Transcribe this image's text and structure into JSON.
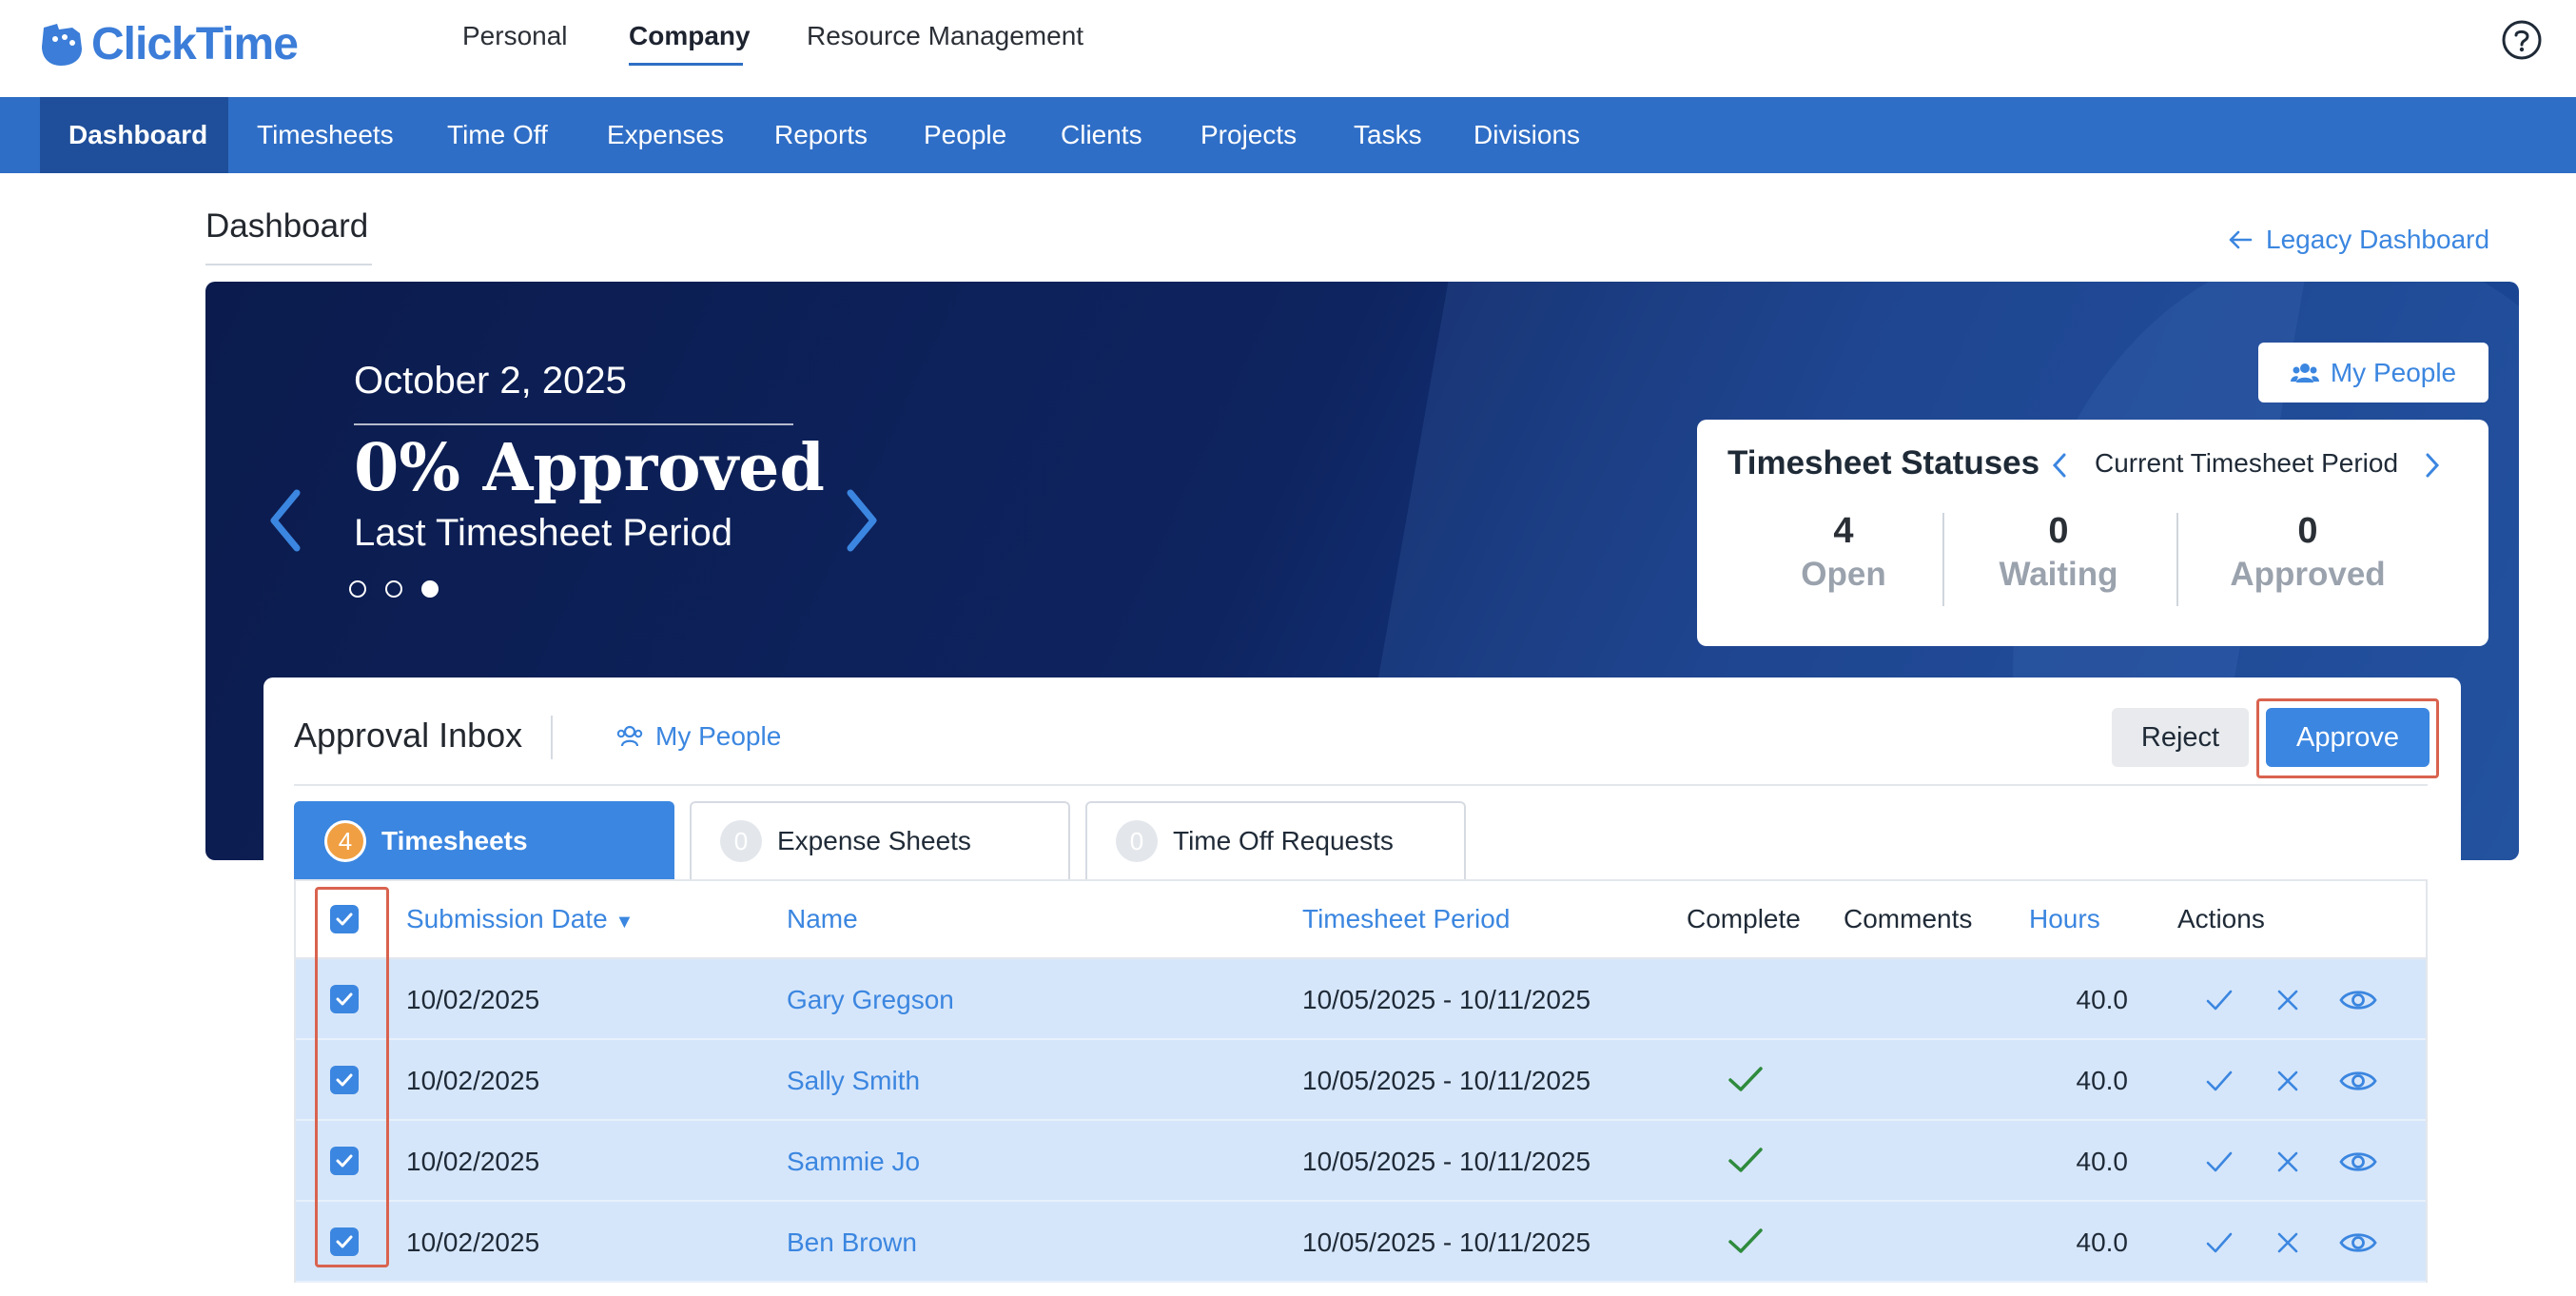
{
  "app": {
    "logo_text": "ClickTime"
  },
  "top_nav": {
    "items": [
      "Personal",
      "Company",
      "Resource Management"
    ],
    "active": "Company"
  },
  "sub_nav": {
    "items": [
      "Dashboard",
      "Timesheets",
      "Time Off",
      "Expenses",
      "Reports",
      "People",
      "Clients",
      "Projects",
      "Tasks",
      "Divisions"
    ],
    "active": "Dashboard"
  },
  "page": {
    "title": "Dashboard",
    "legacy_link": "Legacy Dashboard"
  },
  "hero": {
    "date": "October 2, 2025",
    "percent": "0% Approved",
    "subtitle": "Last Timesheet Period",
    "carousel_index": 3,
    "carousel_count": 3
  },
  "my_people_button": "My People",
  "status_card": {
    "title": "Timesheet Statuses",
    "period": "Current Timesheet Period",
    "stats": [
      {
        "value": "4",
        "label": "Open"
      },
      {
        "value": "0",
        "label": "Waiting"
      },
      {
        "value": "0",
        "label": "Approved"
      }
    ]
  },
  "inbox": {
    "title": "Approval Inbox",
    "my_people": "My People",
    "reject": "Reject",
    "approve": "Approve",
    "tabs": [
      {
        "count": "4",
        "label": "Timesheets"
      },
      {
        "count": "0",
        "label": "Expense Sheets"
      },
      {
        "count": "0",
        "label": "Time Off Requests"
      }
    ],
    "columns": {
      "submission_date": "Submission Date",
      "name": "Name",
      "period": "Timesheet Period",
      "complete": "Complete",
      "comments": "Comments",
      "hours": "Hours",
      "actions": "Actions"
    },
    "rows": [
      {
        "date": "10/02/2025",
        "name": "Gary Gregson",
        "period": "10/05/2025 - 10/11/2025",
        "complete": false,
        "hours": "40.0",
        "checked": true
      },
      {
        "date": "10/02/2025",
        "name": "Sally Smith",
        "period": "10/05/2025 - 10/11/2025",
        "complete": true,
        "hours": "40.0",
        "checked": true
      },
      {
        "date": "10/02/2025",
        "name": "Sammie Jo",
        "period": "10/05/2025 - 10/11/2025",
        "complete": true,
        "hours": "40.0",
        "checked": true
      },
      {
        "date": "10/02/2025",
        "name": "Ben Brown",
        "period": "10/05/2025 - 10/11/2025",
        "complete": true,
        "hours": "40.0",
        "checked": true
      }
    ]
  },
  "colors": {
    "brand": "#3b86e0",
    "nav": "#2f6ec6",
    "nav_active": "#1f4f9a",
    "badge": "#f0a043",
    "highlight": "#d9634f",
    "complete_check": "#2e8b3d",
    "row_bg": "#d6e6fa"
  }
}
